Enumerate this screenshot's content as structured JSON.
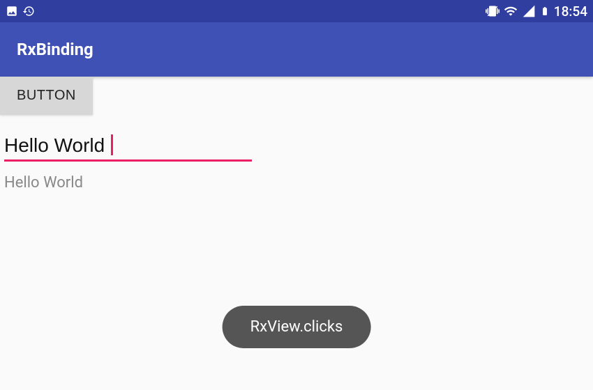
{
  "statusBar": {
    "time": "18:54"
  },
  "appBar": {
    "title": "RxBinding"
  },
  "content": {
    "buttonLabel": "BUTTON",
    "textFieldValue": "Hello World",
    "labelText": "Hello World"
  },
  "toast": {
    "message": "RxView.clicks"
  }
}
